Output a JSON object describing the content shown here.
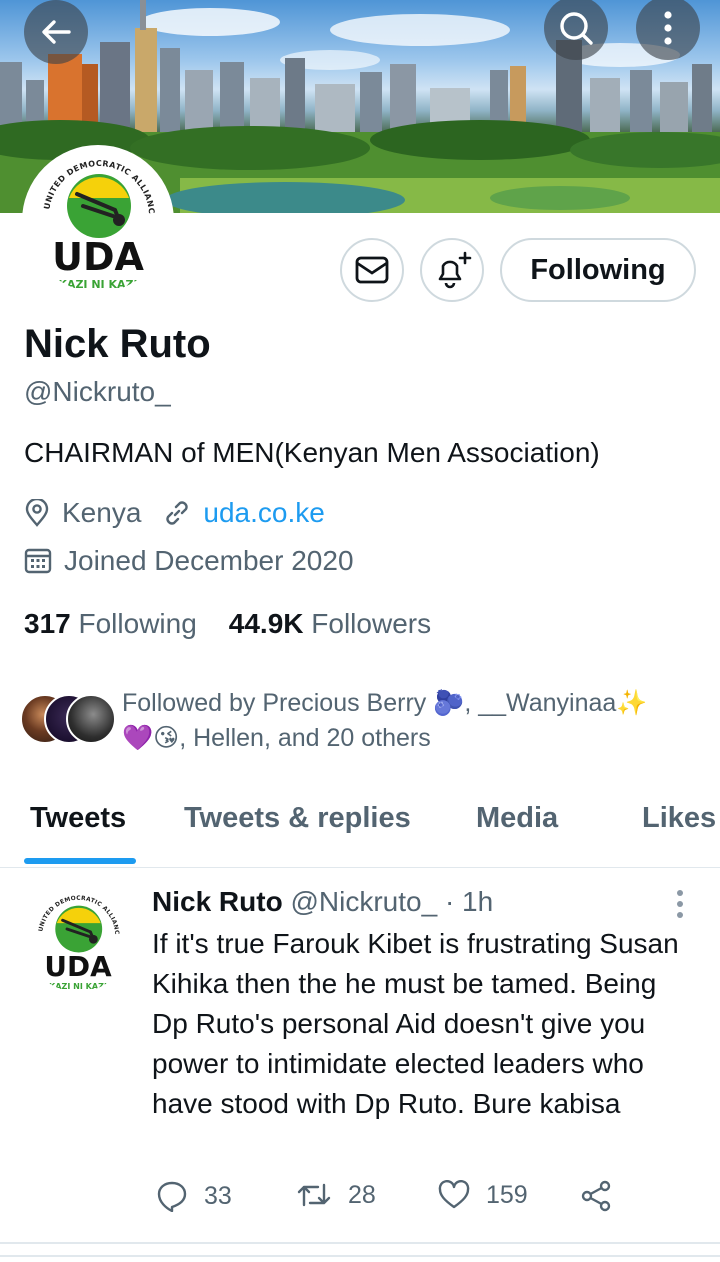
{
  "header": {
    "back_icon": "arrow-left-icon",
    "search_icon": "search-icon",
    "more_icon": "more-vertical-icon"
  },
  "avatar": {
    "logo_text": "UDA",
    "logo_arc_text": "UNITED DEMOCRATIC ALLIANCE",
    "logo_slogan": "KAZI NI KAZI"
  },
  "actions": {
    "message_icon": "envelope-icon",
    "notify_icon": "bell-plus-icon",
    "follow_label": "Following"
  },
  "profile": {
    "name": "Nick Ruto",
    "handle": "@Nickruto_",
    "bio": "CHAIRMAN of MEN(Kenyan Men Association)",
    "location": "Kenya",
    "website": "uda.co.ke",
    "joined": "Joined December 2020",
    "following_count": "317",
    "following_label": "Following",
    "followers_count": "44.9K",
    "followers_label": "Followers"
  },
  "followed_by": {
    "line1": "Followed by Precious Berry 🫐, __Wanyinaa✨",
    "line2": "💜😘, Hellen, and 20 others"
  },
  "tabs": [
    {
      "label": "Tweets",
      "active": true
    },
    {
      "label": "Tweets & replies",
      "active": false
    },
    {
      "label": "Media",
      "active": false
    },
    {
      "label": "Likes",
      "active": false
    }
  ],
  "tweet": {
    "author_name": "Nick Ruto",
    "author_handle": "@Nickruto_",
    "time": "· 1h",
    "text": "If it's true Farouk Kibet is frustrating Susan Kihika then the he must be tamed. Being Dp Ruto's personal Aid doesn't give you power to intimidate elected leaders who have stood with Dp Ruto. Bure kabisa",
    "replies": "33",
    "retweets": "28",
    "likes": "159"
  },
  "colors": {
    "accent": "#1d9bf0",
    "text_primary": "#0f1419",
    "text_secondary": "#536471",
    "uda_green": "#3aa335",
    "uda_yellow": "#f5d10b"
  }
}
